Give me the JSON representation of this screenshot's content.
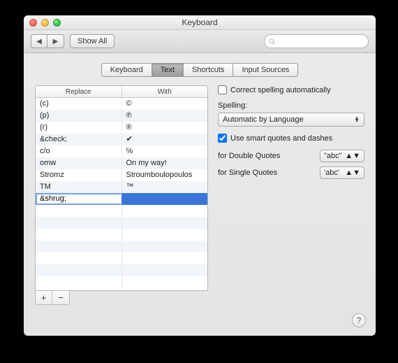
{
  "window": {
    "title": "Keyboard"
  },
  "toolbar": {
    "back_icon": "◀",
    "fwd_icon": "▶",
    "show_all": "Show All",
    "search_placeholder": ""
  },
  "tabs": [
    "Keyboard",
    "Text",
    "Shortcuts",
    "Input Sources"
  ],
  "active_tab": 1,
  "table": {
    "headers": {
      "replace": "Replace",
      "with": "With"
    },
    "rows": [
      {
        "replace": "(c)",
        "with": "©"
      },
      {
        "replace": "(p)",
        "with": "℗"
      },
      {
        "replace": "(r)",
        "with": "®"
      },
      {
        "replace": "&check;",
        "with": "✔"
      },
      {
        "replace": "c/o",
        "with": "℅"
      },
      {
        "replace": "omw",
        "with": "On my way!"
      },
      {
        "replace": "Stromz",
        "with": "Stroumboulopoulos"
      },
      {
        "replace": "TM",
        "with": "™"
      }
    ],
    "editing": {
      "replace": "&shrug;",
      "with": ""
    }
  },
  "buttons": {
    "add": "+",
    "remove": "−"
  },
  "options": {
    "correct_spelling": {
      "label": "Correct spelling automatically",
      "checked": false
    },
    "spelling_label": "Spelling:",
    "spelling_value": "Automatic by Language",
    "smart_quotes": {
      "label": "Use smart quotes and dashes",
      "checked": true
    },
    "double_label": "for Double Quotes",
    "double_value": "\"abc\"",
    "single_label": "for Single Quotes",
    "single_value": "'abc'"
  },
  "help": "?"
}
